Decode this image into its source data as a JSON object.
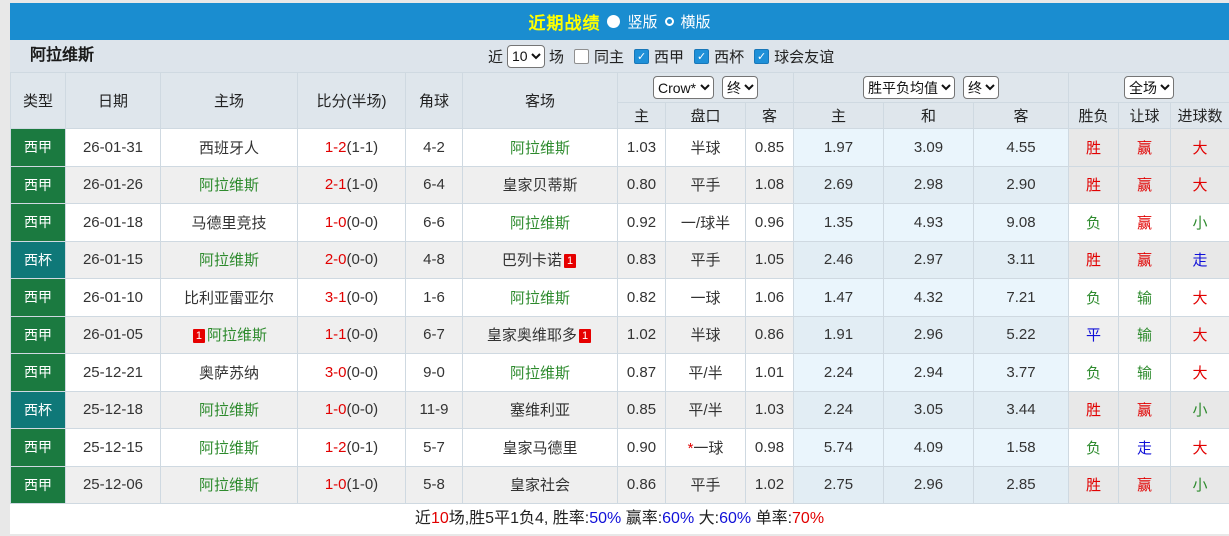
{
  "palette": {
    "topbar_blue": "#1a8dd0",
    "title_yellow": "#ffff00",
    "filterbar_bg": "#dde4eb",
    "header_bg": "#dfe6ec",
    "liga_green": "#1b7a40",
    "cup_teal": "#0f7878",
    "team_green": "#2e8b2e",
    "result_red": "#e10000",
    "result_blue": "#1010d8",
    "avg_col_blue": "#eaf5fc",
    "checkbox_blue": "#1e90d8"
  },
  "topbar": {
    "title": "近期战绩",
    "layout_options": [
      {
        "label": "竖版",
        "selected": true
      },
      {
        "label": "横版",
        "selected": false
      }
    ]
  },
  "filterbar": {
    "team": "阿拉维斯",
    "recent_label": "近",
    "recent_value": "10",
    "recent_suffix": "场",
    "checkboxes": [
      {
        "label": "同主",
        "checked": false
      },
      {
        "label": "西甲",
        "checked": true
      },
      {
        "label": "西杯",
        "checked": true
      },
      {
        "label": "球会友谊",
        "checked": true
      }
    ]
  },
  "table": {
    "headers_left": [
      "类型",
      "日期",
      "主场",
      "比分(半场)",
      "角球",
      "客场"
    ],
    "selects": {
      "odds_company": "Crow*",
      "odds_period": "终",
      "avg_type": "胜平负均值",
      "avg_period": "终",
      "scope": "全场"
    },
    "sub_headers": [
      "主",
      "盘口",
      "客",
      "主",
      "和",
      "客",
      "胜负",
      "让球",
      "进球数"
    ],
    "rows": [
      {
        "league": "西甲",
        "league_class": "liga",
        "date": "26-01-31",
        "home": "西班牙人",
        "home_green": false,
        "home_badge": "",
        "score": "1-2",
        "half": "(1-1)",
        "corners": "4-2",
        "away": "阿拉维斯",
        "away_green": true,
        "away_badge": "",
        "o_home": "1.03",
        "star": "",
        "handicap": "半球",
        "o_away": "0.85",
        "a_home": "1.97",
        "a_draw": "3.09",
        "a_away": "4.55",
        "res": "胜",
        "res_c": "red",
        "hres": "赢",
        "hres_c": "red",
        "goals": "大",
        "goals_c": "red",
        "win": true
      },
      {
        "league": "西甲",
        "league_class": "liga",
        "date": "26-01-26",
        "home": "阿拉维斯",
        "home_green": true,
        "home_badge": "",
        "score": "2-1",
        "half": "(1-0)",
        "corners": "6-4",
        "away": "皇家贝蒂斯",
        "away_green": false,
        "away_badge": "",
        "o_home": "0.80",
        "star": "",
        "handicap": "平手",
        "o_away": "1.08",
        "a_home": "2.69",
        "a_draw": "2.98",
        "a_away": "2.90",
        "res": "胜",
        "res_c": "red",
        "hres": "赢",
        "hres_c": "red",
        "goals": "大",
        "goals_c": "red",
        "win": true
      },
      {
        "league": "西甲",
        "league_class": "liga",
        "date": "26-01-18",
        "home": "马德里竞技",
        "home_green": false,
        "home_badge": "",
        "score": "1-0",
        "half": "(0-0)",
        "corners": "6-6",
        "away": "阿拉维斯",
        "away_green": true,
        "away_badge": "",
        "o_home": "0.92",
        "star": "",
        "handicap": "一/球半",
        "o_away": "0.96",
        "a_home": "1.35",
        "a_draw": "4.93",
        "a_away": "9.08",
        "res": "负",
        "res_c": "green",
        "hres": "赢",
        "hres_c": "red",
        "goals": "小",
        "goals_c": "green",
        "win": false
      },
      {
        "league": "西杯",
        "league_class": "cup",
        "date": "26-01-15",
        "home": "阿拉维斯",
        "home_green": true,
        "home_badge": "",
        "score": "2-0",
        "half": "(0-0)",
        "corners": "4-8",
        "away": "巴列卡诺",
        "away_green": false,
        "away_badge": "1",
        "o_home": "0.83",
        "star": "",
        "handicap": "平手",
        "o_away": "1.05",
        "a_home": "2.46",
        "a_draw": "2.97",
        "a_away": "3.11",
        "res": "胜",
        "res_c": "red",
        "hres": "赢",
        "hres_c": "red",
        "goals": "走",
        "goals_c": "blue",
        "win": true
      },
      {
        "league": "西甲",
        "league_class": "liga",
        "date": "26-01-10",
        "home": "比利亚雷亚尔",
        "home_green": false,
        "home_badge": "",
        "score": "3-1",
        "half": "(0-0)",
        "corners": "1-6",
        "away": "阿拉维斯",
        "away_green": true,
        "away_badge": "",
        "o_home": "0.82",
        "star": "",
        "handicap": "一球",
        "o_away": "1.06",
        "a_home": "1.47",
        "a_draw": "4.32",
        "a_away": "7.21",
        "res": "负",
        "res_c": "green",
        "hres": "输",
        "hres_c": "green",
        "goals": "大",
        "goals_c": "red",
        "win": false
      },
      {
        "league": "西甲",
        "league_class": "liga",
        "date": "26-01-05",
        "home": "阿拉维斯",
        "home_green": true,
        "home_badge": "1",
        "score": "1-1",
        "half": "(0-0)",
        "corners": "6-7",
        "away": "皇家奥维耶多",
        "away_green": false,
        "away_badge": "1",
        "o_home": "1.02",
        "star": "",
        "handicap": "半球",
        "o_away": "0.86",
        "a_home": "1.91",
        "a_draw": "2.96",
        "a_away": "5.22",
        "res": "平",
        "res_c": "blue",
        "hres": "输",
        "hres_c": "green",
        "goals": "大",
        "goals_c": "red",
        "win": false
      },
      {
        "league": "西甲",
        "league_class": "liga",
        "date": "25-12-21",
        "home": "奥萨苏纳",
        "home_green": false,
        "home_badge": "",
        "score": "3-0",
        "half": "(0-0)",
        "corners": "9-0",
        "away": "阿拉维斯",
        "away_green": true,
        "away_badge": "",
        "o_home": "0.87",
        "star": "",
        "handicap": "平/半",
        "o_away": "1.01",
        "a_home": "2.24",
        "a_draw": "2.94",
        "a_away": "3.77",
        "res": "负",
        "res_c": "green",
        "hres": "输",
        "hres_c": "green",
        "goals": "大",
        "goals_c": "red",
        "win": false
      },
      {
        "league": "西杯",
        "league_class": "cup",
        "date": "25-12-18",
        "home": "阿拉维斯",
        "home_green": true,
        "home_badge": "",
        "score": "1-0",
        "half": "(0-0)",
        "corners": "11-9",
        "away": "塞维利亚",
        "away_green": false,
        "away_badge": "",
        "o_home": "0.85",
        "star": "",
        "handicap": "平/半",
        "o_away": "1.03",
        "a_home": "2.24",
        "a_draw": "3.05",
        "a_away": "3.44",
        "res": "胜",
        "res_c": "red",
        "hres": "赢",
        "hres_c": "red",
        "goals": "小",
        "goals_c": "green",
        "win": true
      },
      {
        "league": "西甲",
        "league_class": "liga",
        "date": "25-12-15",
        "home": "阿拉维斯",
        "home_green": true,
        "home_badge": "",
        "score": "1-2",
        "half": "(0-1)",
        "corners": "5-7",
        "away": "皇家马德里",
        "away_green": false,
        "away_badge": "",
        "o_home": "0.90",
        "star": "*",
        "handicap": "一球",
        "o_away": "0.98",
        "a_home": "5.74",
        "a_draw": "4.09",
        "a_away": "1.58",
        "res": "负",
        "res_c": "green",
        "hres": "走",
        "hres_c": "blue",
        "goals": "大",
        "goals_c": "red",
        "win": false
      },
      {
        "league": "西甲",
        "league_class": "liga",
        "date": "25-12-06",
        "home": "阿拉维斯",
        "home_green": true,
        "home_badge": "",
        "score": "1-0",
        "half": "(1-0)",
        "corners": "5-8",
        "away": "皇家社会",
        "away_green": false,
        "away_badge": "",
        "o_home": "0.86",
        "star": "",
        "handicap": "平手",
        "o_away": "1.02",
        "a_home": "2.75",
        "a_draw": "2.96",
        "a_away": "2.85",
        "res": "胜",
        "res_c": "red",
        "hres": "赢",
        "hres_c": "red",
        "goals": "小",
        "goals_c": "green",
        "win": true
      }
    ]
  },
  "footer": {
    "parts": [
      {
        "text": "近",
        "color": "dark"
      },
      {
        "text": "10",
        "color": "red"
      },
      {
        "text": "场,胜5平1负4, 胜率:",
        "color": "dark"
      },
      {
        "text": "50%",
        "color": "blue"
      },
      {
        "text": " 赢率:",
        "color": "dark"
      },
      {
        "text": "60%",
        "color": "blue"
      },
      {
        "text": " 大:",
        "color": "dark"
      },
      {
        "text": "60%",
        "color": "blue"
      },
      {
        "text": " 单率:",
        "color": "dark"
      },
      {
        "text": "70%",
        "color": "red"
      }
    ]
  }
}
